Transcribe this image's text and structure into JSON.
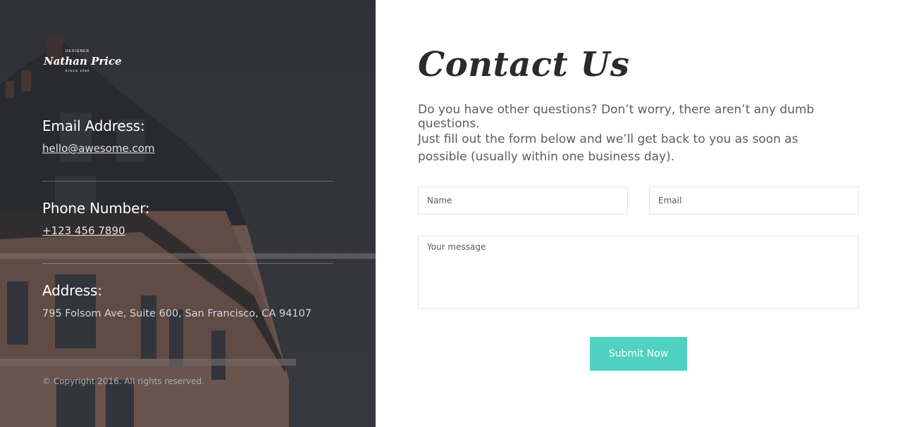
{
  "brand": {
    "top_text": "DESIGNER",
    "name": "Nathan Price",
    "since": "SINCE 1990"
  },
  "contact_info": {
    "email_heading": "Email Address:",
    "email_value": "hello@awesome.com",
    "phone_heading": "Phone Number:",
    "phone_value": "+123 456 7890",
    "address_heading": "Address:",
    "address_value": "795 Folsom Ave, Suite 600, San Francisco, CA 94107"
  },
  "copyright": "© Copyright 2016. All rights reserved.",
  "main": {
    "title": "Contact Us",
    "lead1": "Do you have other questions? Don’t worry, there aren’t any dumb questions.",
    "lead2": "Just fill out the form below and we’ll get back to you as soon as possible (usually within one business day)."
  },
  "form": {
    "name_placeholder": "Name",
    "email_placeholder": "Email",
    "message_placeholder": "Your message",
    "submit_label": "Submit Now"
  },
  "colors": {
    "accent": "#4fd1c1",
    "left_panel_bg": "#3d3e42",
    "title_text": "#2b2b2e",
    "body_text": "#5d5d61"
  }
}
